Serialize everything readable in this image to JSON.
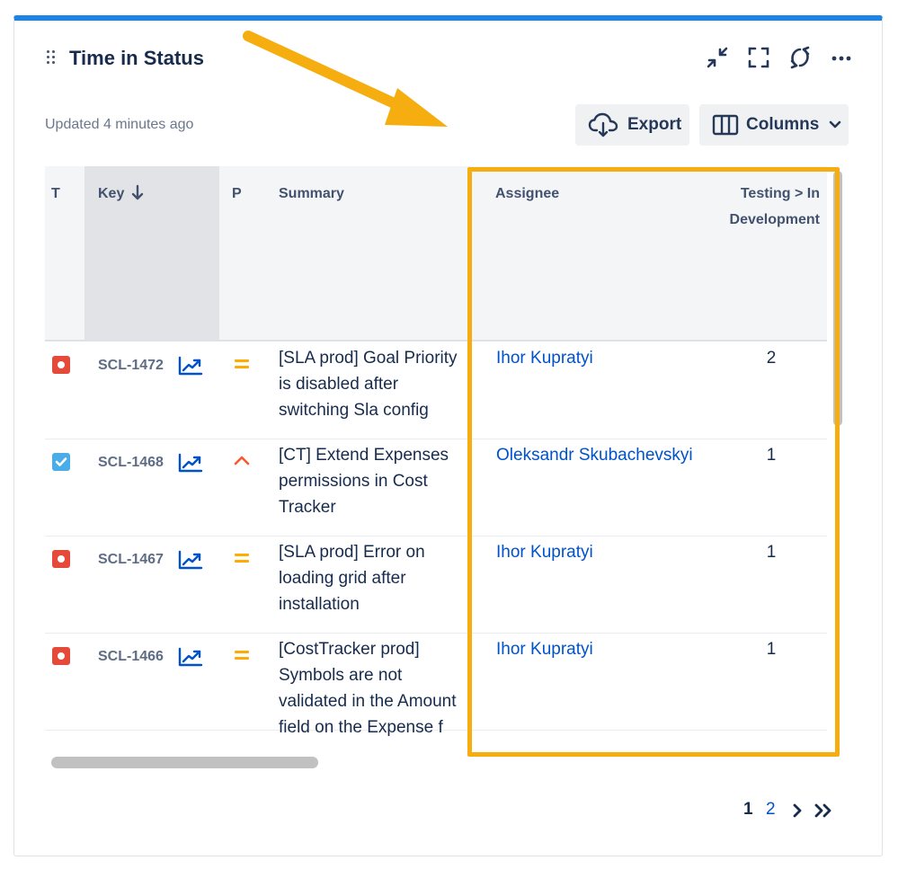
{
  "widget": {
    "title": "Time in Status",
    "updated": "Updated 4 minutes ago",
    "accent_color": "#1b84e9",
    "header_icons": [
      "collapse-icon",
      "fullscreen-icon",
      "refresh-icon",
      "more-icon"
    ]
  },
  "toolbar": {
    "export_label": "Export",
    "columns_label": "Columns"
  },
  "table": {
    "columns": [
      "T",
      "Key",
      "P",
      "Summary",
      "Assignee",
      "Testing > In Development"
    ],
    "key_sort": "descending",
    "rows": [
      {
        "type": "bug",
        "key": "SCL-1472",
        "priority": "medium",
        "summary": "[SLA prod] Goal Priority is disabled after switching Sla config",
        "assignee": "Ihor Kupratyi",
        "value": "2"
      },
      {
        "type": "task",
        "key": "SCL-1468",
        "priority": "high",
        "summary": "[CT] Extend Expenses permissions in Cost Tracker",
        "assignee": "Oleksandr Skubachevskyi",
        "value": "1"
      },
      {
        "type": "bug",
        "key": "SCL-1467",
        "priority": "medium",
        "summary": "[SLA prod] Error on loading grid after installation",
        "assignee": "Ihor Kupratyi",
        "value": "1"
      },
      {
        "type": "bug",
        "key": "SCL-1466",
        "priority": "medium",
        "summary": "[CostTracker prod] Symbols are not validated in the Amount field on the Expense f",
        "assignee": "Ihor Kupratyi",
        "value": "1"
      }
    ]
  },
  "pagination": {
    "current": "1",
    "next_page": "2"
  },
  "annotation": {
    "highlight_color": "#f5ad0f"
  }
}
